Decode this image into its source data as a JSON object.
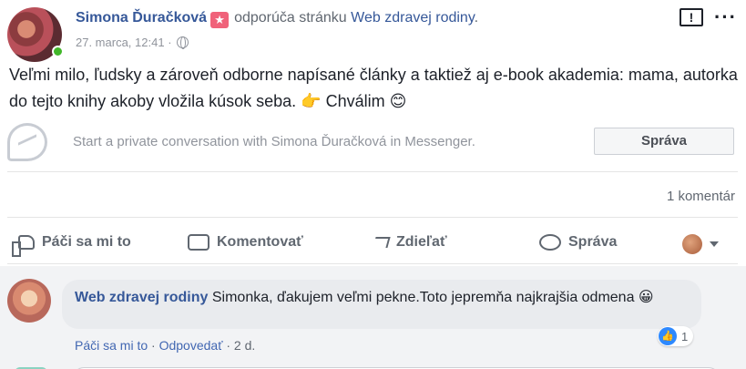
{
  "post": {
    "author": "Simona Ďuračková",
    "badge_icon": "star-icon",
    "badge_glyph": "★",
    "action_text": "odporúča stránku",
    "page_name": "Web zdravej rodiny",
    "period": ".",
    "date": "27. marca, 12:41",
    "meta_separator": "·",
    "privacy_icon": "globe-icon",
    "text": "Veľmi milo, ľudsky a zároveň odborne napísané články a taktiež aj e-book akademia: mama, autorka do tejto knihy akoby vložila kúsok seba. 👉 Chválim 😊",
    "report_glyph": "!",
    "more_glyph": "···"
  },
  "messenger": {
    "prompt": "Start a private conversation with Simona Ďuračková in Messenger.",
    "button_label": "Správa"
  },
  "stats": {
    "comments": "1 komentár"
  },
  "actions": {
    "like": "Páči sa mi to",
    "comment": "Komentovať",
    "share": "Zdieľať",
    "message": "Správa"
  },
  "comment": {
    "author": "Web zdravej rodiny",
    "text": "Simonka, ďakujem veľmi pekne.Toto jepremňa najkrajšia odmena 😀",
    "like": "Páči sa mi to",
    "separator": " · ",
    "reply": "Odpovedať",
    "age": "2 d.",
    "reaction_glyph": "👍",
    "reaction_count": "1"
  },
  "colors": {
    "link": "#365899",
    "muted": "#606770",
    "online": "#42b72a",
    "reaction": "#2e89ff"
  }
}
